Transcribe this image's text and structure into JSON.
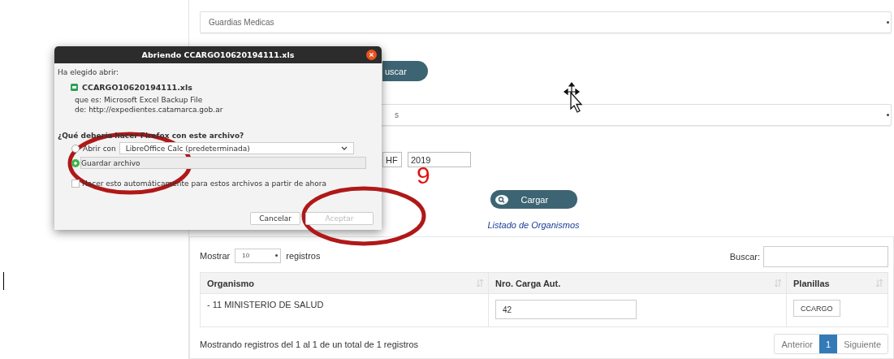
{
  "page": {
    "select_1": "Guardias Medicas",
    "search_button": "uscar",
    "select_2": "s",
    "period_fields": [
      "HF",
      "2019"
    ],
    "load_button": "Cargar",
    "list_title": "Listado de Organismos",
    "table": {
      "show_label": "Mostrar",
      "page_size": "10",
      "records_label": "registros",
      "search_label": "Buscar:",
      "columns": [
        "Organismo",
        "Nro. Carga Aut.",
        "Planillas"
      ],
      "rows": [
        {
          "organismo": "- 11 MINISTERIO DE SALUD",
          "nro_carga": "42",
          "planilla": "CCARGO"
        }
      ],
      "info": "Mostrando registros del 1 al 1 de un total de 1 registros",
      "pagination": [
        {
          "label": "Anterior",
          "selected": false
        },
        {
          "label": "1",
          "selected": true
        },
        {
          "label": "Siguiente",
          "selected": false
        }
      ]
    }
  },
  "dialog": {
    "title": "Abriendo CCARGO10620194111.xls",
    "intro": "Ha elegido abrir:",
    "file_name": "CCARGO10620194111.xls",
    "file_type": "que es: Microsoft Excel Backup File",
    "source": "de: http://expedientes.catamarca.gob.ar",
    "question": "¿Qué debería hacer Firefox con este archivo?",
    "options": [
      {
        "kind": "open_with",
        "label": "Abrir con",
        "value": "LibreOffice Calc (predeterminada)",
        "selected": false
      },
      {
        "kind": "save",
        "label": "Guardar archivo",
        "selected": true
      }
    ],
    "auto_checkbox": {
      "label": "Hacer esto automáticamente para estos archivos a partir de ahora",
      "checked": false
    },
    "buttons": [
      {
        "label": "Cancelar",
        "disabled": false
      },
      {
        "label": "Aceptar",
        "disabled": true
      }
    ]
  },
  "annotation": {
    "step": "9"
  }
}
